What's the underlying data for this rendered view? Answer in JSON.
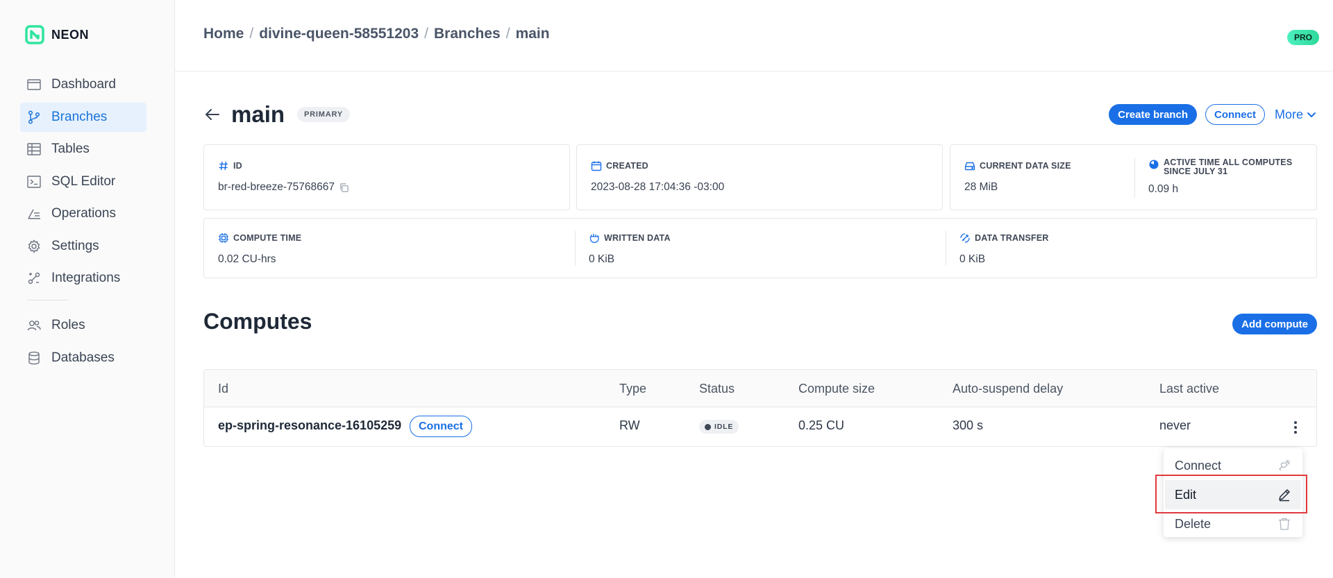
{
  "sidebar": {
    "logo_text": "NEON",
    "items": [
      {
        "label": "Dashboard",
        "icon": "dashboard-icon"
      },
      {
        "label": "Branches",
        "icon": "branches-icon",
        "active": true
      },
      {
        "label": "Tables",
        "icon": "tables-icon"
      },
      {
        "label": "SQL Editor",
        "icon": "sql-editor-icon"
      },
      {
        "label": "Operations",
        "icon": "operations-icon"
      },
      {
        "label": "Settings",
        "icon": "gear-icon"
      },
      {
        "label": "Integrations",
        "icon": "integrations-icon"
      },
      {
        "label": "Roles",
        "icon": "roles-icon"
      },
      {
        "label": "Databases",
        "icon": "database-icon"
      }
    ]
  },
  "header": {
    "breadcrumb": [
      "Home",
      "divine-queen-58551203",
      "Branches",
      "main"
    ],
    "separator": "/",
    "plan_badge": "PRO"
  },
  "branch": {
    "title": "main",
    "tag": "PRIMARY",
    "actions": {
      "create_branch": "Create branch",
      "connect": "Connect",
      "more": "More"
    }
  },
  "metrics": {
    "id": {
      "label": "ID",
      "value": "br-red-breeze-75768667"
    },
    "created": {
      "label": "CREATED",
      "value": "2023-08-28 17:04:36 -03:00"
    },
    "data_size": {
      "label": "CURRENT DATA SIZE",
      "value": "28 MiB"
    },
    "active_time": {
      "label": "ACTIVE TIME ALL COMPUTES",
      "label2": "SINCE JULY 31",
      "value": "0.09 h"
    },
    "compute_time": {
      "label": "COMPUTE TIME",
      "value": "0.02 CU-hrs"
    },
    "written_data": {
      "label": "WRITTEN DATA",
      "value": "0 KiB"
    },
    "data_transfer": {
      "label": "DATA TRANSFER",
      "value": "0 KiB"
    }
  },
  "computes": {
    "title": "Computes",
    "add_button": "Add compute",
    "columns": [
      "Id",
      "Type",
      "Status",
      "Compute size",
      "Auto-suspend delay",
      "Last active"
    ],
    "rows": [
      {
        "id": "ep-spring-resonance-16105259",
        "connect": "Connect",
        "type": "RW",
        "status": "IDLE",
        "compute_size": "0.25 CU",
        "auto_suspend": "300 s",
        "last_active": "never"
      }
    ]
  },
  "row_menu": {
    "items": [
      {
        "label": "Connect",
        "icon": "plug-icon"
      },
      {
        "label": "Edit",
        "icon": "pencil-icon",
        "highlighted": true
      },
      {
        "label": "Delete",
        "icon": "trash-icon"
      }
    ]
  },
  "colors": {
    "accent": "#1a6fe6",
    "active_nav_bg": "#e6f1fd",
    "highlight_border": "#e0393e",
    "pro_badge": "#2ed99a"
  }
}
